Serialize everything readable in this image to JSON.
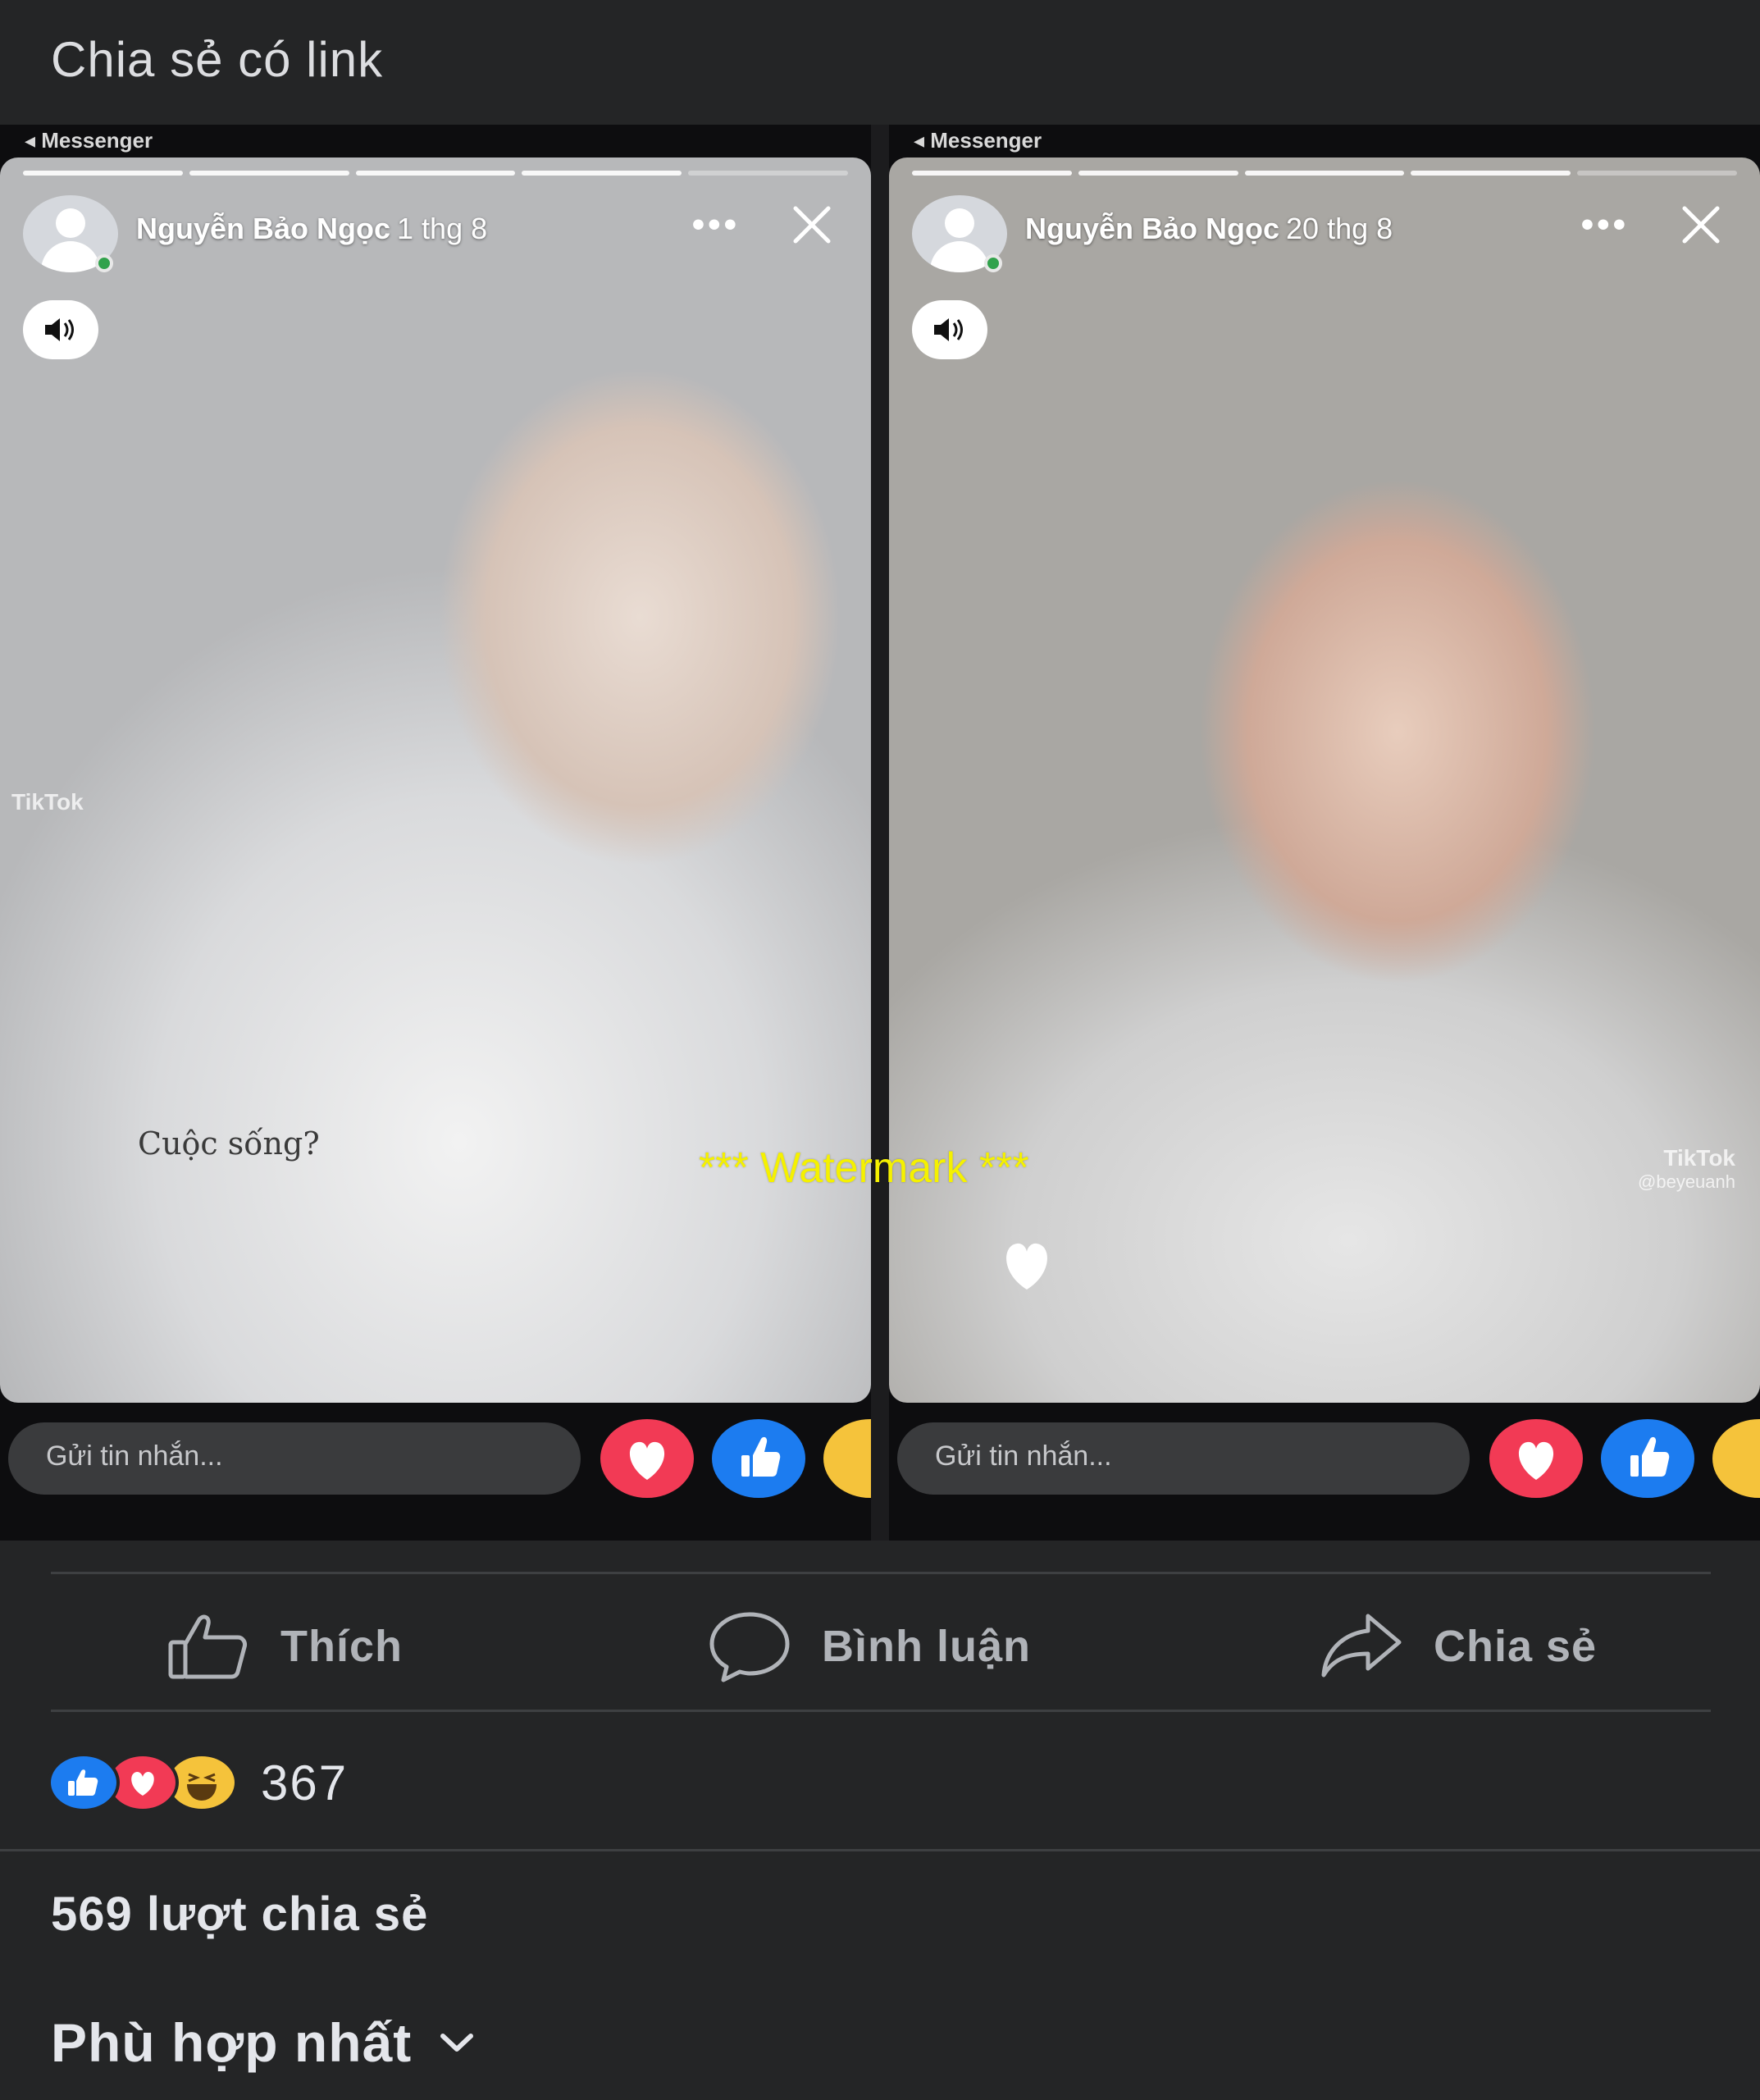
{
  "header": {
    "title": "Chia sẻ có link"
  },
  "stories": [
    {
      "app_back": "◂ Messenger",
      "author": "Nguyễn Bảo Ngọc",
      "date": "1 thg 8",
      "caption": "Cuộc sống?",
      "watermark_app": "TikTok",
      "reply_placeholder": "Gửi tin nhắn..."
    },
    {
      "app_back": "◂ Messenger",
      "author": "Nguyễn Bảo Ngọc",
      "date": "20 thg 8",
      "watermark_app": "TikTok",
      "watermark_handle": "@beyeuanh",
      "reply_placeholder": "Gửi tin nhắn..."
    }
  ],
  "overlay": {
    "watermark": "*** Watermark ***"
  },
  "actions": {
    "like": "Thích",
    "comment": "Bình luận",
    "share": "Chia sẻ"
  },
  "reactions": {
    "count": "367",
    "icons": [
      "like-icon",
      "love-icon",
      "haha-icon"
    ]
  },
  "shares": {
    "text": "569 lượt chia sẻ"
  },
  "sort": {
    "label": "Phù hợp nhất"
  },
  "colors": {
    "background": "#242526",
    "text": "#e4e6eb",
    "muted": "#b0b3b8",
    "like_blue": "#1c7cf0",
    "love_red": "#f23a55",
    "haha_yellow": "#f5c33b",
    "watermark_yellow": "#f5f100"
  }
}
